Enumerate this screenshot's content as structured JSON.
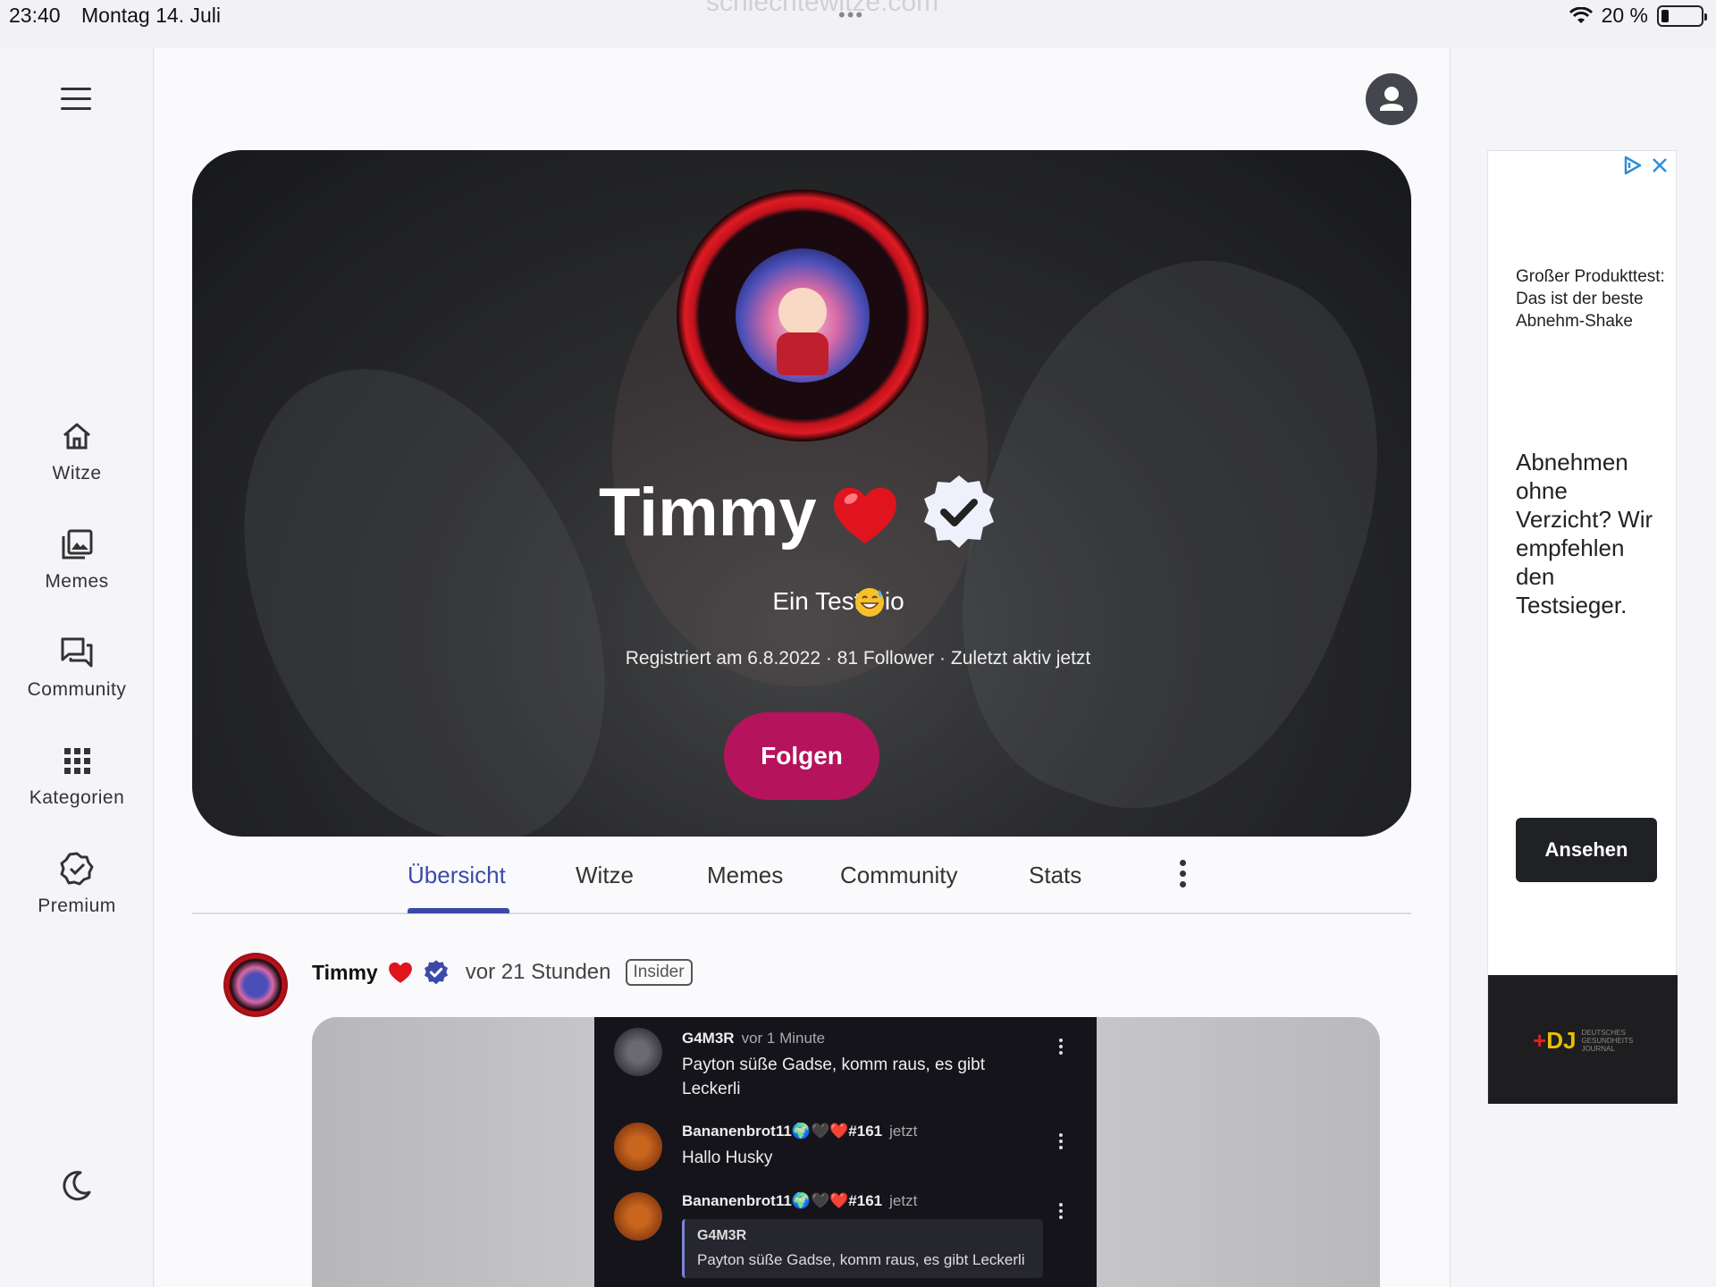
{
  "status_bar": {
    "time": "23:40",
    "date": "Montag 14. Juli",
    "url": "schlechtewitze.com",
    "dots": "•••",
    "battery": "20 %",
    "battery_level": 0.2
  },
  "sidebar": {
    "items": [
      {
        "label": "Witze",
        "icon": "home-icon"
      },
      {
        "label": "Memes",
        "icon": "gallery-icon"
      },
      {
        "label": "Community",
        "icon": "chat-icon"
      },
      {
        "label": "Kategorien",
        "icon": "grid-icon"
      },
      {
        "label": "Premium",
        "icon": "badge-icon"
      }
    ]
  },
  "profile": {
    "name": "Timmy",
    "bio": "Ein Test Bio",
    "meta": "Registriert am 6.8.2022 · 81 Follower · Zuletzt aktiv jetzt",
    "follow_label": "Folgen",
    "accent": "#b5135c"
  },
  "tabs": [
    {
      "label": "Übersicht",
      "active": true
    },
    {
      "label": "Witze"
    },
    {
      "label": "Memes"
    },
    {
      "label": "Community"
    },
    {
      "label": "Stats"
    }
  ],
  "post": {
    "author": "Timmy",
    "time": "vor 21 Stunden",
    "badge": "Insider",
    "chat": [
      {
        "name": "G4M3R",
        "when": "vor 1 Minute",
        "text": "Payton süße Gadse, komm raus, es gibt Leckerli"
      },
      {
        "name": "Bananenbrot11🌍🖤❤️#161",
        "when": "jetzt",
        "text": "Hallo Husky"
      },
      {
        "name": "Bananenbrot11🌍🖤❤️#161",
        "when": "jetzt",
        "quote_name": "G4M3R",
        "quote_text": "Payton süße Gadse, komm raus, es gibt Leckerli"
      }
    ]
  },
  "ad": {
    "small_text": "Großer Produkttest: Das ist der beste Abnehm-Shake",
    "big_text": "Abnehmen ohne Verzicht? Wir empfehlen den Testsieger.",
    "button": "Ansehen",
    "logo_mark": "DJ",
    "logo_text": "DEUTSCHES GESUNDHEITS JOURNAL"
  }
}
